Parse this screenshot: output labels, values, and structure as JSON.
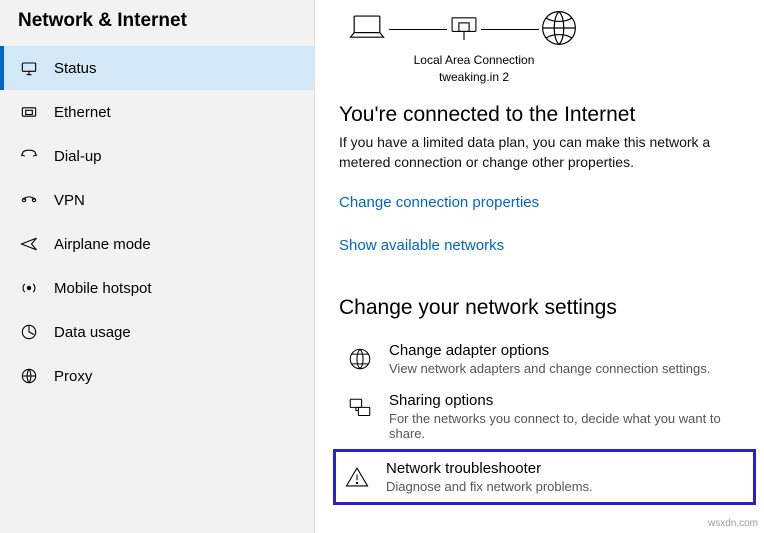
{
  "sidebar": {
    "title": "Network & Internet",
    "items": [
      {
        "label": "Status",
        "icon": "status"
      },
      {
        "label": "Ethernet",
        "icon": "ethernet"
      },
      {
        "label": "Dial-up",
        "icon": "dialup"
      },
      {
        "label": "VPN",
        "icon": "vpn"
      },
      {
        "label": "Airplane mode",
        "icon": "airplane"
      },
      {
        "label": "Mobile hotspot",
        "icon": "hotspot"
      },
      {
        "label": "Data usage",
        "icon": "usage"
      },
      {
        "label": "Proxy",
        "icon": "proxy"
      }
    ]
  },
  "diagram": {
    "label_line1": "Local Area Connection",
    "label_line2": "tweaking.in 2"
  },
  "status": {
    "heading": "You're connected to the Internet",
    "desc": "If you have a limited data plan, you can make this network a metered connection or change other properties.",
    "link_properties": "Change connection properties",
    "link_networks": "Show available networks"
  },
  "settings": {
    "heading": "Change your network settings",
    "rows": [
      {
        "title": "Change adapter options",
        "sub": "View network adapters and change connection settings."
      },
      {
        "title": "Sharing options",
        "sub": "For the networks you connect to, decide what you want to share."
      },
      {
        "title": "Network troubleshooter",
        "sub": "Diagnose and fix network problems."
      }
    ]
  },
  "watermark": "wsxdn.com"
}
